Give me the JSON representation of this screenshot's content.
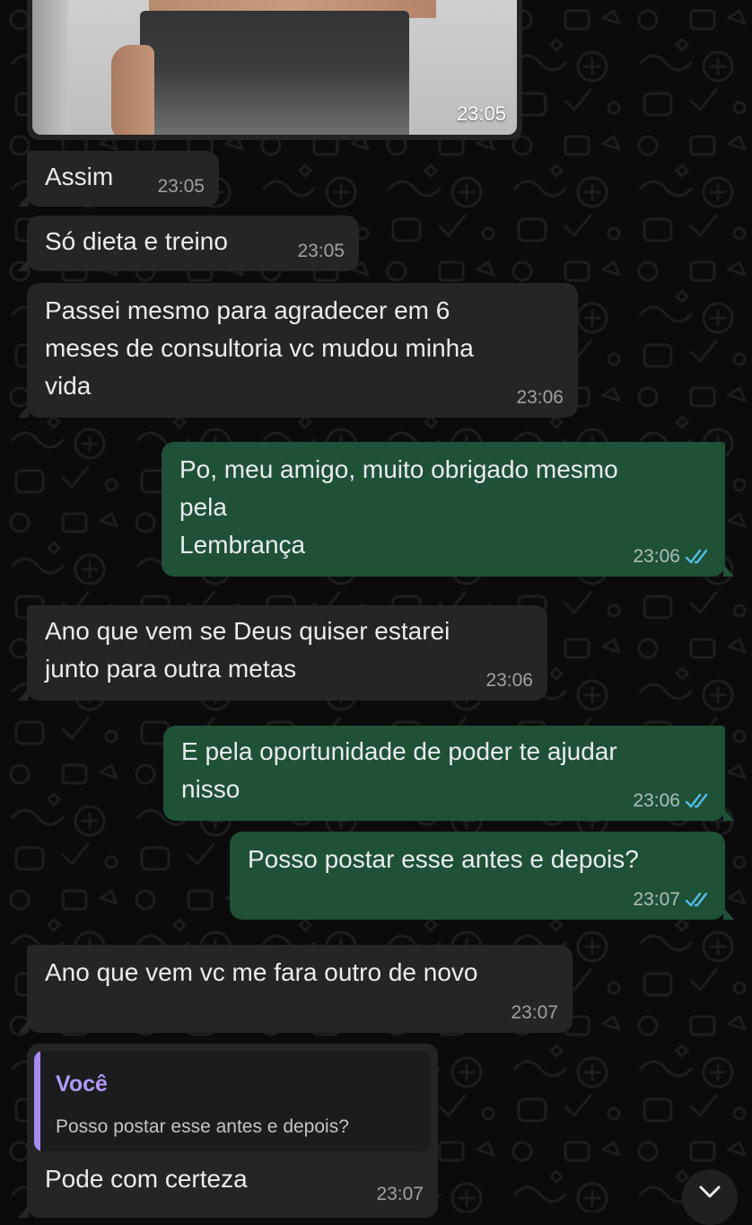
{
  "theme": {
    "incoming_bubble": "#242526",
    "outgoing_bubble": "#1f5136",
    "read_ticks": "#53bdeb",
    "reply_accent": "#b399f7"
  },
  "chat": {
    "photo_message": {
      "time": "23:05"
    },
    "messages": [
      {
        "text": "Assim",
        "time": "23:05"
      },
      {
        "text": "Só dieta e treino",
        "time": "23:05"
      },
      {
        "text": "Passei mesmo para agradecer em 6\nmeses de consultoria vc mudou minha\nvida",
        "time": "23:06"
      },
      {
        "text": "Po, meu amigo, muito obrigado mesmo\npela\nLembrança",
        "time": "23:06"
      },
      {
        "text": "Ano que vem se Deus quiser estarei\njunto para outra metas",
        "time": "23:06"
      },
      {
        "text": "E pela oportunidade de poder te ajudar\nnisso",
        "time": "23:06"
      },
      {
        "text": "Posso postar esse antes e depois?",
        "time": "23:07"
      },
      {
        "text": "Ano que vem vc me fara outro de novo",
        "time": "23:07"
      },
      {
        "text": "Pode com certeza",
        "time": "23:07"
      }
    ],
    "reply_quote": {
      "author": "Você",
      "text": "Posso postar esse antes e depois?"
    }
  },
  "icons": {
    "read_ticks": "double-check-icon",
    "scroll_down": "chevron-down-icon"
  }
}
